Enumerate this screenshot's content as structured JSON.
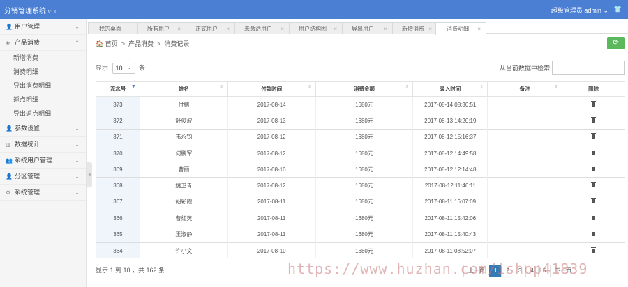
{
  "app": {
    "title": "分销管理系统",
    "version": "v1.0",
    "user_label": "超级管理员",
    "user_name": "admin",
    "user_caret": "⌄",
    "shirt": "👕"
  },
  "sidebar": {
    "collapse_arrow": "◂",
    "items": [
      {
        "label": "用户管理",
        "icon": "user-icon",
        "glyph": "👤",
        "chevron": "⌄"
      },
      {
        "label": "产品消费",
        "icon": "layers-icon",
        "glyph": "◈",
        "chevron": "⌃"
      },
      {
        "label": "参数设置",
        "icon": "user-icon",
        "glyph": "👤",
        "chevron": "⌄"
      },
      {
        "label": "数据统计",
        "icon": "chart-icon",
        "glyph": "▥",
        "chevron": "⌄"
      },
      {
        "label": "系统用户管理",
        "icon": "users-icon",
        "glyph": "👥",
        "chevron": "⌄"
      },
      {
        "label": "分区管理",
        "icon": "user-icon",
        "glyph": "👤",
        "chevron": "⌄"
      },
      {
        "label": "系统管理",
        "icon": "gear-icon",
        "glyph": "⚙",
        "chevron": "⌄"
      }
    ],
    "sub_items": [
      "新增消费",
      "消费明细",
      "导出消费明细",
      "返点明细",
      "导出返点明细"
    ]
  },
  "tabs": [
    {
      "label": "我的桌面",
      "close": ""
    },
    {
      "label": "所有用户",
      "close": "×"
    },
    {
      "label": "正式用户",
      "close": "×"
    },
    {
      "label": "未激活用户",
      "close": "×"
    },
    {
      "label": "用户结构图",
      "close": "×"
    },
    {
      "label": "导出用户",
      "close": "×"
    },
    {
      "label": "新增消费",
      "close": "×"
    },
    {
      "label": "消费明细",
      "close": "×"
    }
  ],
  "breadcrumb": {
    "home_glyph": "🏠",
    "home": "首页",
    "sep": ">",
    "level1": "产品消费",
    "level2": "消费记录"
  },
  "refresh_glyph": "⟳",
  "table_controls": {
    "show": "显示",
    "page_size": "10",
    "dd": "⌄",
    "unit": "条",
    "search_label": "从当前数据中检索"
  },
  "table": {
    "headers": [
      "流水号",
      "姓名",
      "付款时间",
      "消费金额",
      "录入时间",
      "备注",
      "删除"
    ],
    "sort_glyph": "▼",
    "sort_glyph_off": "⇕",
    "rows": [
      {
        "id": "373",
        "name": "付鹏",
        "pay_time": "2017-08-14",
        "amount": "1680元",
        "entry_time": "2017-08-14 08:30:51",
        "note": ""
      },
      {
        "id": "372",
        "name": "舒俊波",
        "pay_time": "2017-08-13",
        "amount": "1680元",
        "entry_time": "2017-08-13 14:20:19",
        "note": ""
      },
      {
        "id": "371",
        "name": "韦永钧",
        "pay_time": "2017-08-12",
        "amount": "1680元",
        "entry_time": "2017-08-12 15:16:37",
        "note": ""
      },
      {
        "id": "370",
        "name": "何鹏军",
        "pay_time": "2017-08-12",
        "amount": "1680元",
        "entry_time": "2017-08-12 14:49:58",
        "note": ""
      },
      {
        "id": "369",
        "name": "曹丽",
        "pay_time": "2017-08-10",
        "amount": "1680元",
        "entry_time": "2017-08-12 12:14:48",
        "note": ""
      },
      {
        "id": "368",
        "name": "姚卫青",
        "pay_time": "2017-08-12",
        "amount": "1680元",
        "entry_time": "2017-08-12 11:46:11",
        "note": ""
      },
      {
        "id": "367",
        "name": "胡彩霞",
        "pay_time": "2017-08-11",
        "amount": "1680元",
        "entry_time": "2017-08-11 16:07:09",
        "note": ""
      },
      {
        "id": "366",
        "name": "曹红英",
        "pay_time": "2017-08-11",
        "amount": "1680元",
        "entry_time": "2017-08-11 15:42:06",
        "note": ""
      },
      {
        "id": "365",
        "name": "王淑静",
        "pay_time": "2017-08-11",
        "amount": "1680元",
        "entry_time": "2017-08-11 15:40:43",
        "note": ""
      },
      {
        "id": "364",
        "name": "许小文",
        "pay_time": "2017-08-10",
        "amount": "1680元",
        "entry_time": "2017-08-11 08:52:07",
        "note": ""
      }
    ]
  },
  "footer": {
    "info": "显示 1 到 10 ，共 162 条"
  },
  "pagination": [
    "上一页",
    "1",
    "2",
    "3",
    "4",
    "5",
    "下一页"
  ],
  "watermark": "https://www.huzhan.com/ishop41839",
  "colors": {
    "topbar": "#4a7fd4",
    "refresh": "#5cb85c",
    "active_page": "#337ab7"
  }
}
